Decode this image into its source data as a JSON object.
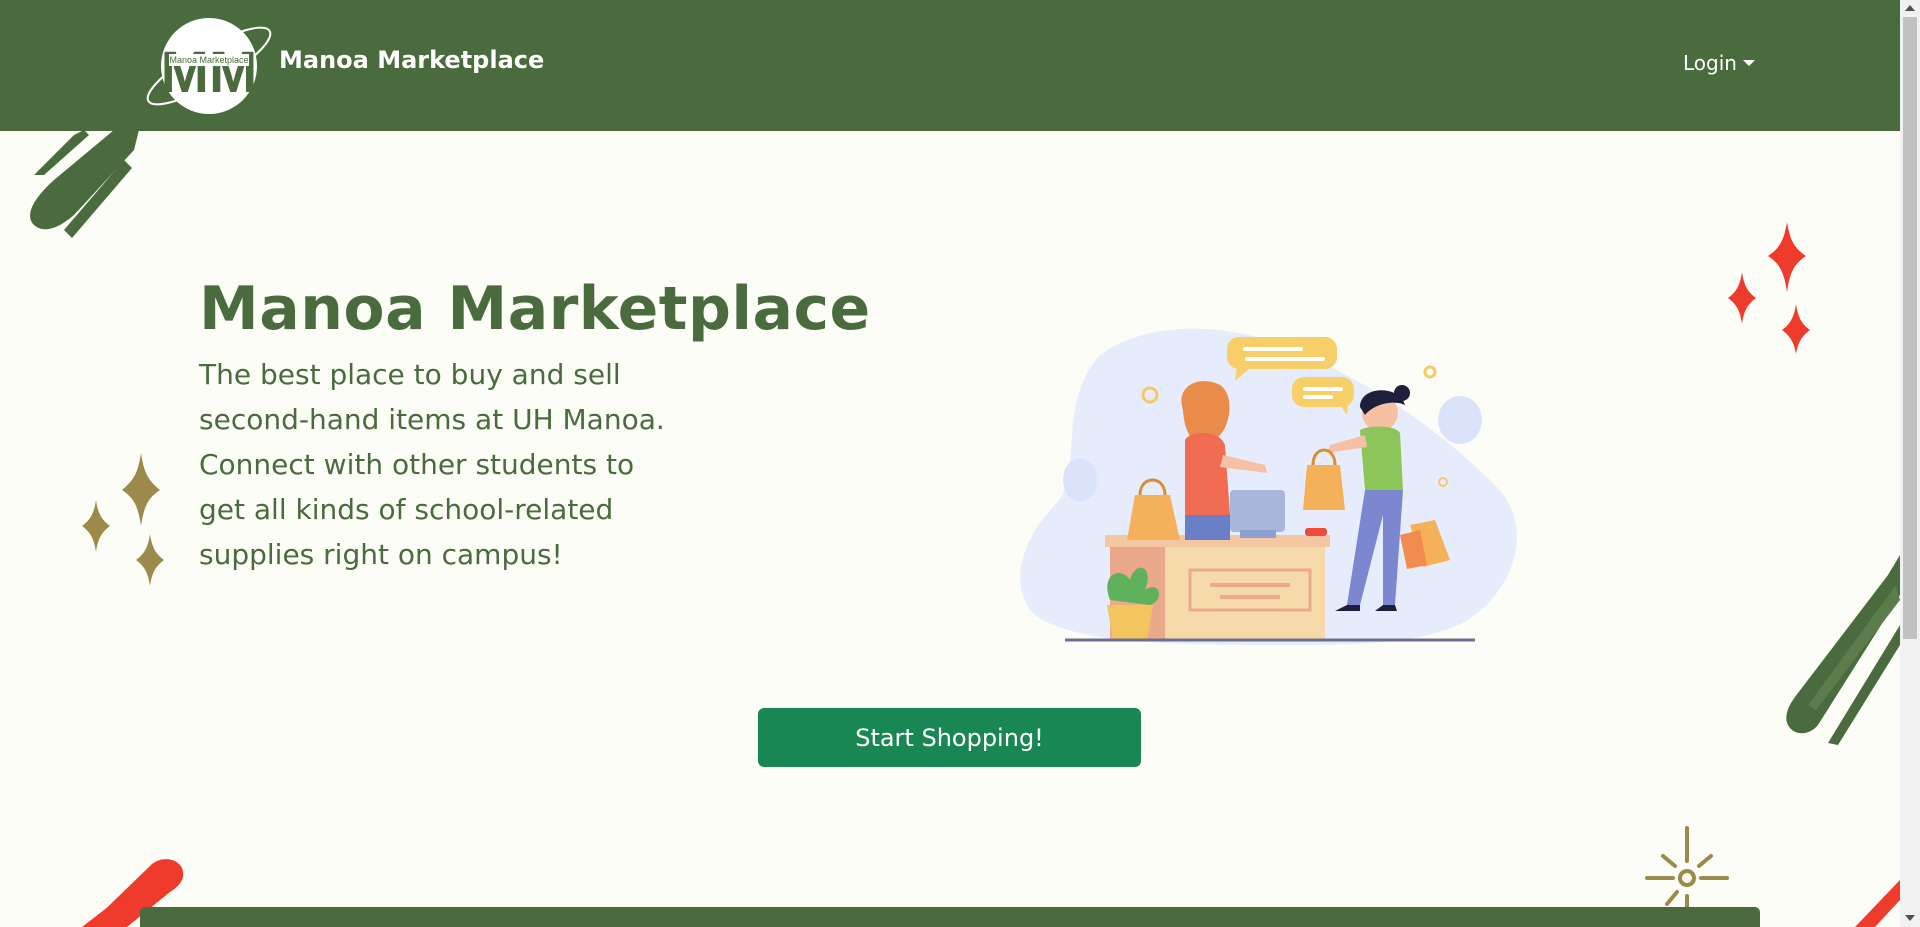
{
  "navbar": {
    "brand_title": "Manoa Marketplace",
    "logo_monogram": "MM",
    "logo_caption": "Manoa Marketplace",
    "login_label": "Login",
    "background": "#4a6b3d"
  },
  "hero": {
    "title": "Manoa Marketplace",
    "description": "The best place to buy and sell second-hand items at UH Manoa. Connect with other students to get all kinds of school-related supplies right on campus!",
    "cta_label": "Start Shopping!",
    "illustration_icon": "shopping-illustration-icon"
  },
  "colors": {
    "brand_green": "#4a6b3d",
    "button_green": "#198754",
    "accent_red": "#ef3b2c",
    "accent_olive": "#9b8a4a",
    "page_background": "#fdfdf7"
  }
}
